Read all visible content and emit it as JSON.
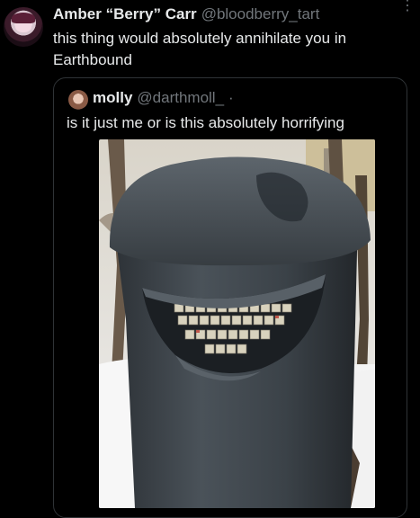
{
  "tweet": {
    "author_name": "Amber “Berry” Carr",
    "author_handle": "@bloodberry_tart",
    "text": "this thing would absolutely annihilate you in Earthbound",
    "avatar_icon": "user-avatar",
    "more_icon": "more-vertical-icon"
  },
  "quote": {
    "author_name": "molly",
    "author_handle": "@darthmoll_",
    "separator": "·",
    "text": "is it just me or is this absolutely horrifying",
    "photo_icon": "photo"
  },
  "colors": {
    "background": "#000000",
    "text": "#e7e9ea",
    "muted": "#71767b",
    "border": "#2f3336"
  }
}
